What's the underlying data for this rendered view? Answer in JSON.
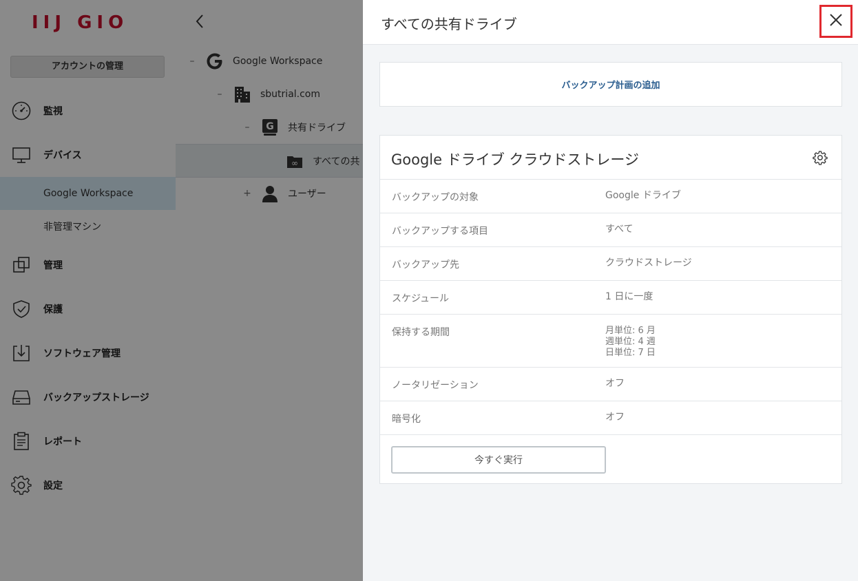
{
  "sidebar": {
    "logo": "IIJ GIO",
    "account_button": "アカウントの管理",
    "items": [
      {
        "label": "監視",
        "icon": "gauge-icon"
      },
      {
        "label": "デバイス",
        "icon": "monitor-icon"
      },
      {
        "label": "管理",
        "icon": "copy-icon"
      },
      {
        "label": "保護",
        "icon": "shield-icon"
      },
      {
        "label": "ソフトウェア管理",
        "icon": "download-tray-icon"
      },
      {
        "label": "バックアップストレージ",
        "icon": "drive-icon"
      },
      {
        "label": "レポート",
        "icon": "clipboard-icon"
      },
      {
        "label": "設定",
        "icon": "gear-icon"
      }
    ],
    "sub_items": [
      {
        "label": "Google Workspace",
        "active": true
      },
      {
        "label": "非管理マシン",
        "active": false
      }
    ]
  },
  "tree": {
    "nodes": [
      {
        "toggle": "–",
        "label": "Google Workspace",
        "icon": "google-g-icon"
      },
      {
        "toggle": "–",
        "label": "sbutrial.com",
        "icon": "building-icon"
      },
      {
        "toggle": "–",
        "label": "共有ドライブ",
        "icon": "google-drive-box-icon"
      },
      {
        "toggle": "",
        "label": "すべての共",
        "icon": "shared-folder-icon"
      },
      {
        "toggle": "+",
        "label": "ユーザー",
        "icon": "user-icon"
      }
    ]
  },
  "panel": {
    "title": "すべての共有ドライブ",
    "add_plan": "バックアップ計画の追加",
    "card": {
      "title": "Google ドライブ クラウドストレージ",
      "rows": [
        {
          "key": "バックアップの対象",
          "value": "Google ドライブ"
        },
        {
          "key": "バックアップする項目",
          "value": "すべて"
        },
        {
          "key": "バックアップ先",
          "value": "クラウドストレージ"
        },
        {
          "key": "スケジュール",
          "value": "1 日に一度"
        },
        {
          "key": "保持する期間",
          "value_lines": [
            "月単位: 6 月",
            "週単位: 4 週",
            "日単位: 7 日"
          ]
        },
        {
          "key": "ノータリゼーション",
          "value": "オフ"
        },
        {
          "key": "暗号化",
          "value": "オフ"
        }
      ],
      "run_button": "今すぐ実行"
    }
  },
  "colors": {
    "brand_red": "#c8102e",
    "link_blue": "#2a5d8f",
    "highlight_red": "#e0282e",
    "active_sub_bg": "#d9ecf7"
  }
}
